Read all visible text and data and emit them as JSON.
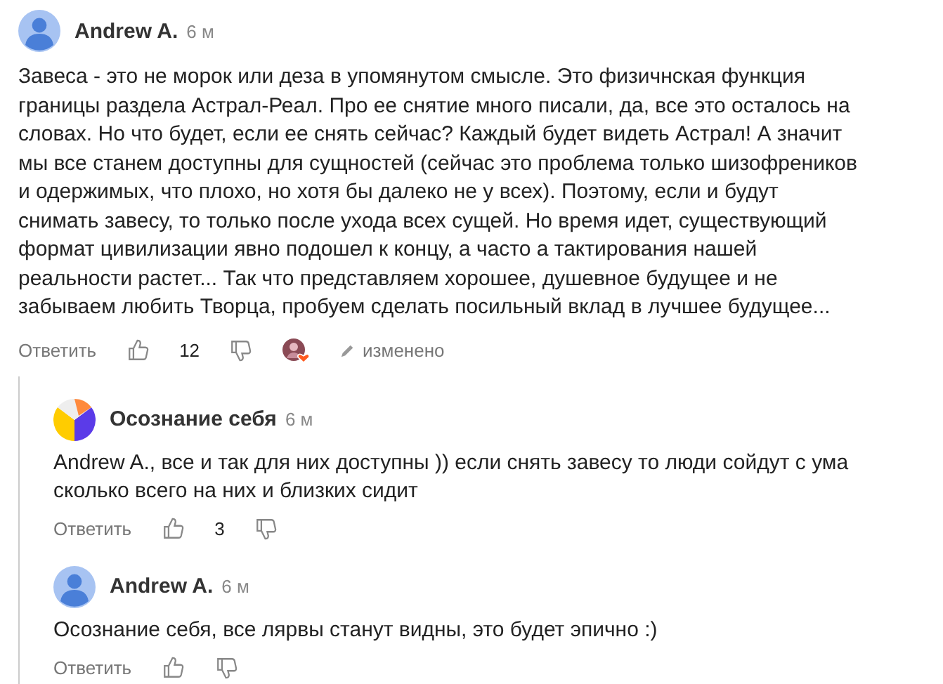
{
  "comments": [
    {
      "author": "Andrew A.",
      "kind": "user",
      "time": "6 м",
      "text": "Завеса - это не морок или деза в упомянутом смысле. Это физичнская функция границы раздела Астрал-Реал. Про ее снятие много писали, да, все это осталось на словах. Но что будет, если ее снять сейчас? Каждый будет видеть Астрал! А значит мы все станем доступны для сущностей (сейчас это проблема только шизофреников и одержимых, что плохо, но хотя бы далеко не у всех). Поэтому, если и будут снимать завесу, то только после ухода всех сущей. Но время идет, существующий формат цивилизации явно подошел к концу, а часто а тактирования нашей реальности растет... Так что представляем хорошее, душевное будущее и не забываем любить Творца, пробуем сделать посильный вклад в лучшее будущее...",
      "reply": "Ответить",
      "likes": "12",
      "author_liked": true,
      "edited": "изменено",
      "replies": [
        {
          "author": "Осознание себя",
          "kind": "channel",
          "time": "6 м",
          "text": "Andrew A., все и так для них доступны )) если снять завесу то люди сойдут с ума сколько всего на них и близких сидит",
          "reply": "Ответить",
          "likes": "3",
          "author_liked": false
        },
        {
          "author": "Andrew A.",
          "kind": "user",
          "time": "6 м",
          "text": "Осознание себя, все лярвы станут видны, это будет эпично :)",
          "reply": "Ответить",
          "author_liked": false
        }
      ]
    }
  ]
}
